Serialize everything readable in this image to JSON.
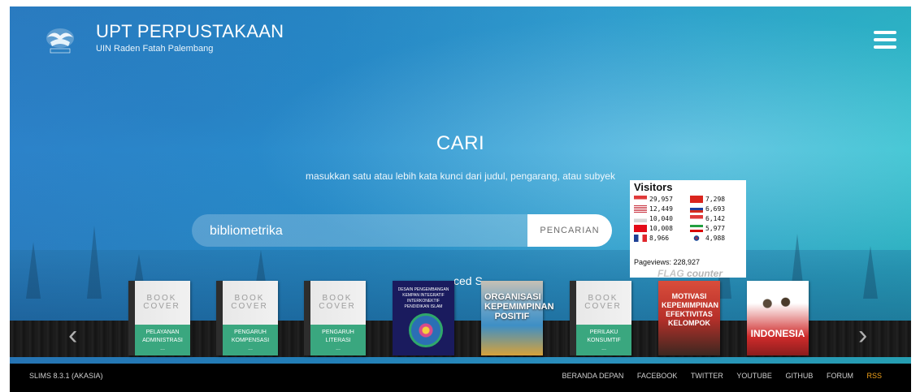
{
  "header": {
    "title": "UPT PERPUSTAKAAN",
    "subtitle": "UIN Raden Fatah Palembang",
    "logo_icon": "university-emblem-icon",
    "menu_icon": "hamburger-icon"
  },
  "search": {
    "heading": "CARI",
    "description": "masukkan satu atau lebih kata kunci dari judul, pengarang, atau subyek",
    "query": "bibliometrika",
    "button_label": "PENCARIAN",
    "advanced_fragment": "ced S"
  },
  "visitors_widget": {
    "title": "Visitors",
    "counts": [
      "29,957",
      "12,449",
      "10,040",
      "10,008",
      "8,966",
      "7,298",
      "6,693",
      "6,142",
      "5,977",
      "4,988"
    ],
    "pageviews": "Pageviews: 228,927",
    "brand": "FLAG",
    "brand_suffix": "counter"
  },
  "books": [
    {
      "cover_word1": "BOOK",
      "cover_word2": "COVER",
      "title": "PELAYANAN ADMINISTRASI",
      "dots": "..."
    },
    {
      "cover_word1": "BOOK",
      "cover_word2": "COVER",
      "title": "PENGARUH KOMPENSASI",
      "dots": "..."
    },
    {
      "cover_word1": "BOOK",
      "cover_word2": "COVER",
      "title": "PENGARUH LITERASI",
      "dots": "..."
    },
    {
      "cover_text": "DESAIN PENGEMBANGAN KEMPAN INTEGRATIF INTERKONEKTIF PENDIDIKAN ISLAM"
    },
    {
      "cover_text": "ORGANISASI KEPEMIMPINAN POSITIF"
    },
    {
      "cover_word1": "BOOK",
      "cover_word2": "COVER",
      "title": "PERILAKU KONSUMTIF",
      "dots": "..."
    },
    {
      "cover_text": "MOTIVASI KEPEMIMPINAN EFEKTIVITAS KELOMPOK"
    },
    {
      "cover_text": "INDONESIA"
    }
  ],
  "carousel": {
    "prev_icon": "chevron-left-icon",
    "next_icon": "chevron-right-icon"
  },
  "footer": {
    "version": "SLIMS 8.3.1 (AKASIA)",
    "links": [
      "BERANDA DEPAN",
      "FACEBOOK",
      "TWITTER",
      "YOUTUBE",
      "GITHUB",
      "FORUM",
      "RSS"
    ]
  },
  "colors": {
    "accent_green": "#3aa77f",
    "rss_orange": "#f2a31b",
    "hero_blue": "#2a98d6"
  }
}
